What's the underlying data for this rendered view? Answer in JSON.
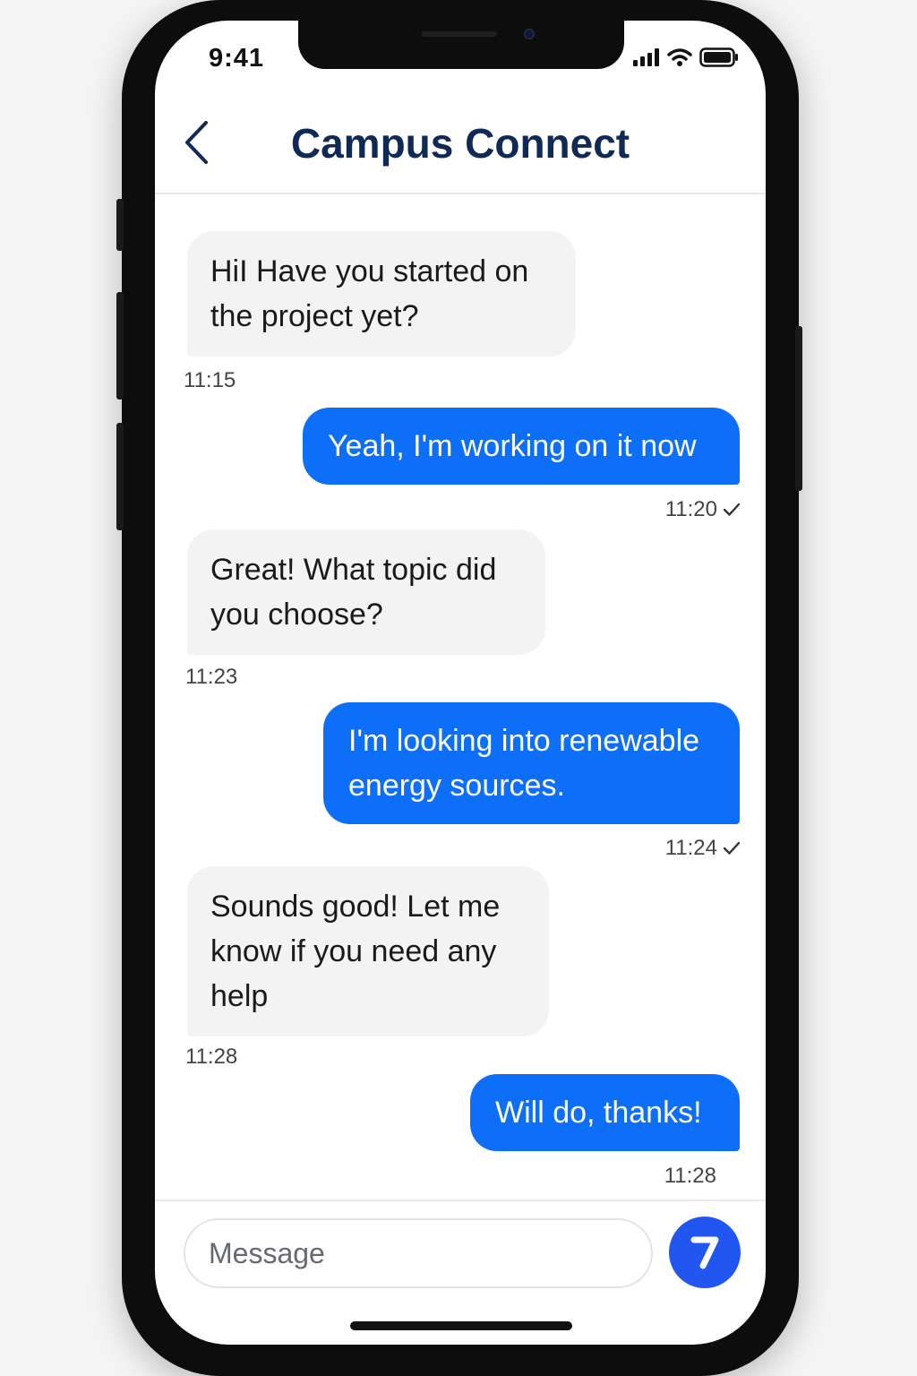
{
  "status_bar": {
    "time": "9:41",
    "icons": [
      "signal-icon",
      "wifi-icon",
      "battery-icon"
    ]
  },
  "header": {
    "title": "Campus Connect",
    "back_icon": "chevron-left-icon"
  },
  "messages": [
    {
      "direction": "incoming",
      "text": "HiI Have you started on the project yet?",
      "time": "11:15"
    },
    {
      "direction": "outgoing",
      "text": "Yeah, I'm working on it now",
      "time": "11:20",
      "read_icon": "check-icon"
    },
    {
      "direction": "incoming",
      "text": "Great! What topic did you choose?",
      "time": "11:23"
    },
    {
      "direction": "outgoing",
      "text": "I'm looking into renewable energy sources.",
      "time": "11:24",
      "read_icon": "check-icon"
    },
    {
      "direction": "incoming",
      "text": "Sounds good! Let me know if you need any help",
      "time": "11:28"
    },
    {
      "direction": "outgoing",
      "text": "Will do, thanks!",
      "time": "11:28"
    }
  ],
  "composer": {
    "placeholder": "Message",
    "value": "",
    "send_icon": "send-icon"
  },
  "colors": {
    "outgoing_bubble": "#0d6ef8",
    "incoming_bubble": "#f3f3f4",
    "title": "#102a56",
    "send_button": "#2157f0"
  }
}
